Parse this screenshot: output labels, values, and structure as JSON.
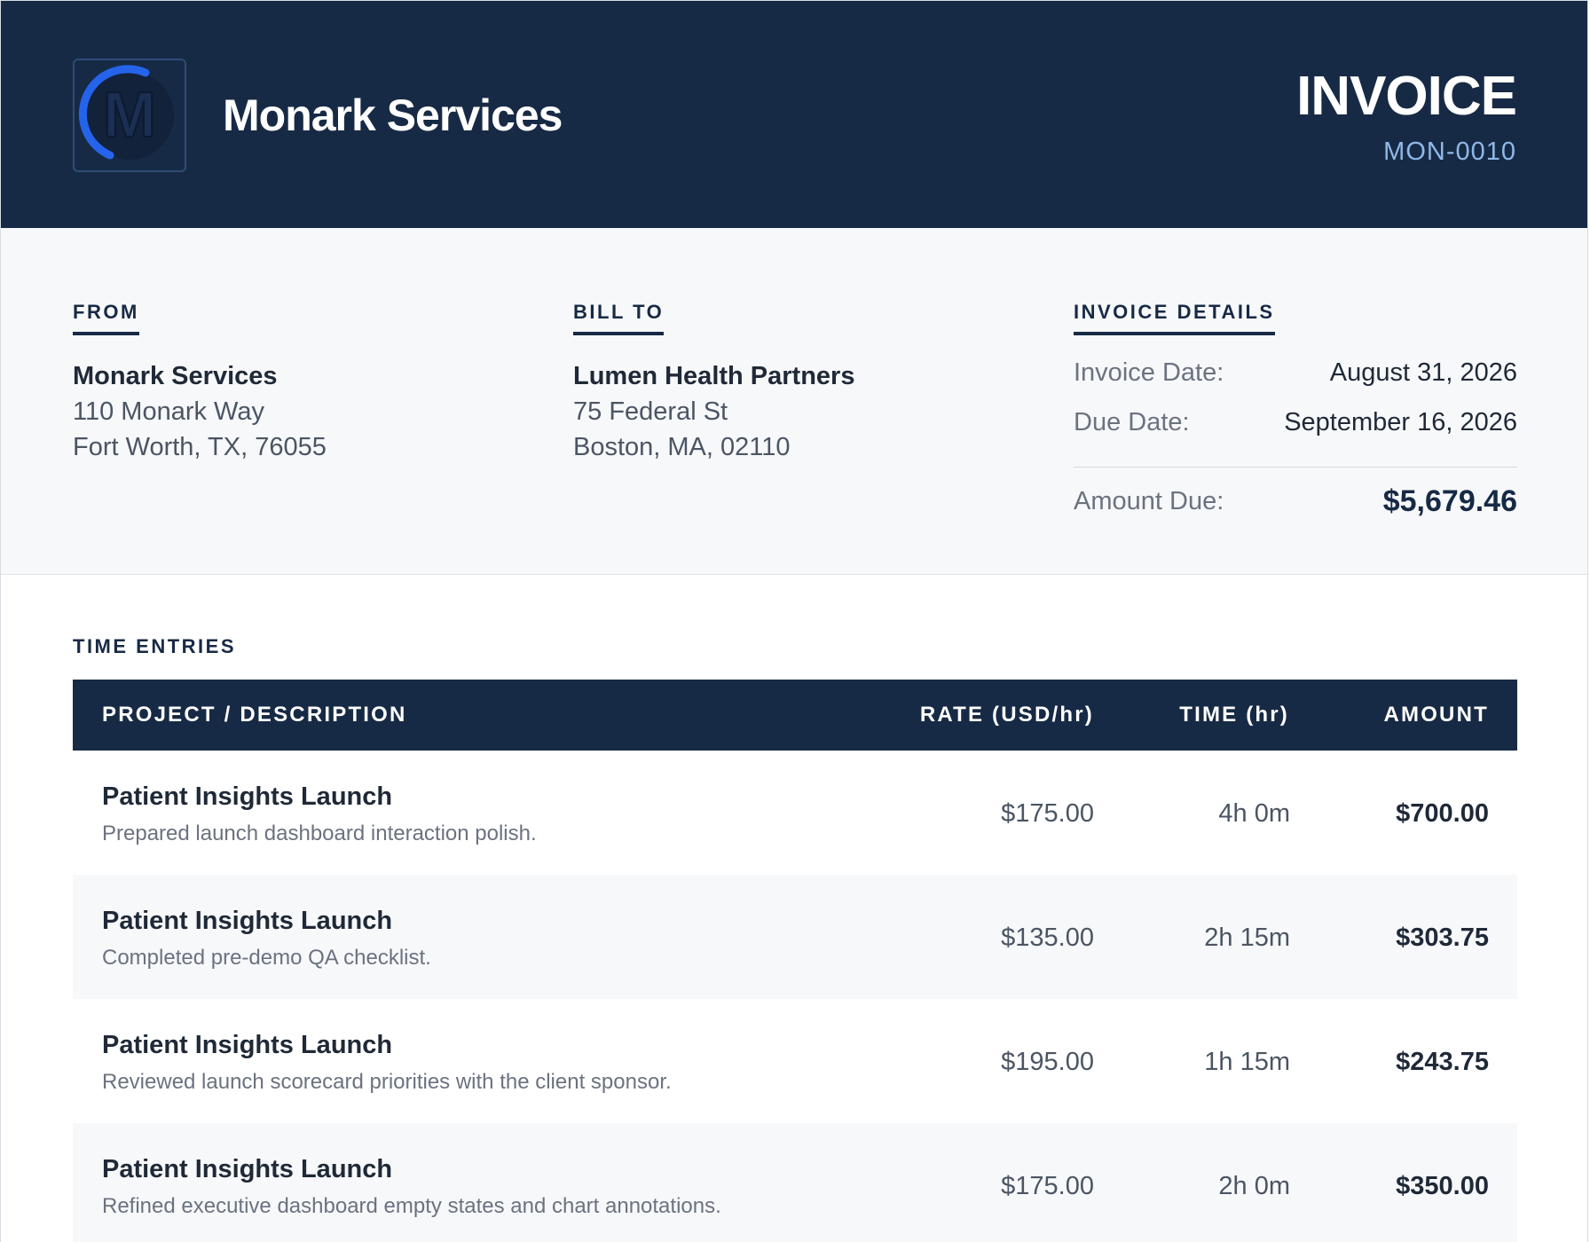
{
  "header": {
    "company_name": "Monark Services",
    "title": "INVOICE",
    "invoice_number": "MON-0010",
    "logo_letter": "M"
  },
  "from": {
    "label": "FROM",
    "name": "Monark Services",
    "address_line1": "110 Monark Way",
    "address_line2": "Fort Worth, TX, 76055"
  },
  "bill_to": {
    "label": "BILL TO",
    "name": "Lumen Health Partners",
    "address_line1": "75 Federal St",
    "address_line2": "Boston, MA, 02110"
  },
  "details": {
    "label": "INVOICE DETAILS",
    "invoice_date_label": "Invoice Date:",
    "invoice_date": "August 31, 2026",
    "due_date_label": "Due Date:",
    "due_date": "September 16, 2026",
    "amount_due_label": "Amount Due:",
    "amount_due": "$5,679.46"
  },
  "time_entries": {
    "label": "TIME ENTRIES",
    "columns": {
      "description": "PROJECT / DESCRIPTION",
      "rate": "RATE (USD/hr)",
      "time": "TIME (hr)",
      "amount": "AMOUNT"
    },
    "rows": [
      {
        "project": "Patient Insights Launch",
        "description": "Prepared launch dashboard interaction polish.",
        "rate": "$175.00",
        "time": "4h 0m",
        "amount": "$700.00"
      },
      {
        "project": "Patient Insights Launch",
        "description": "Completed pre-demo QA checklist.",
        "rate": "$135.00",
        "time": "2h 15m",
        "amount": "$303.75"
      },
      {
        "project": "Patient Insights Launch",
        "description": "Reviewed launch scorecard priorities with the client sponsor.",
        "rate": "$195.00",
        "time": "1h 15m",
        "amount": "$243.75"
      },
      {
        "project": "Patient Insights Launch",
        "description": "Refined executive dashboard empty states and chart annotations.",
        "rate": "$175.00",
        "time": "2h 0m",
        "amount": "$350.00"
      }
    ]
  },
  "colors": {
    "navy": "#172a45",
    "accent_blue": "#8fb8e8",
    "logo_ring": "#2563eb"
  }
}
